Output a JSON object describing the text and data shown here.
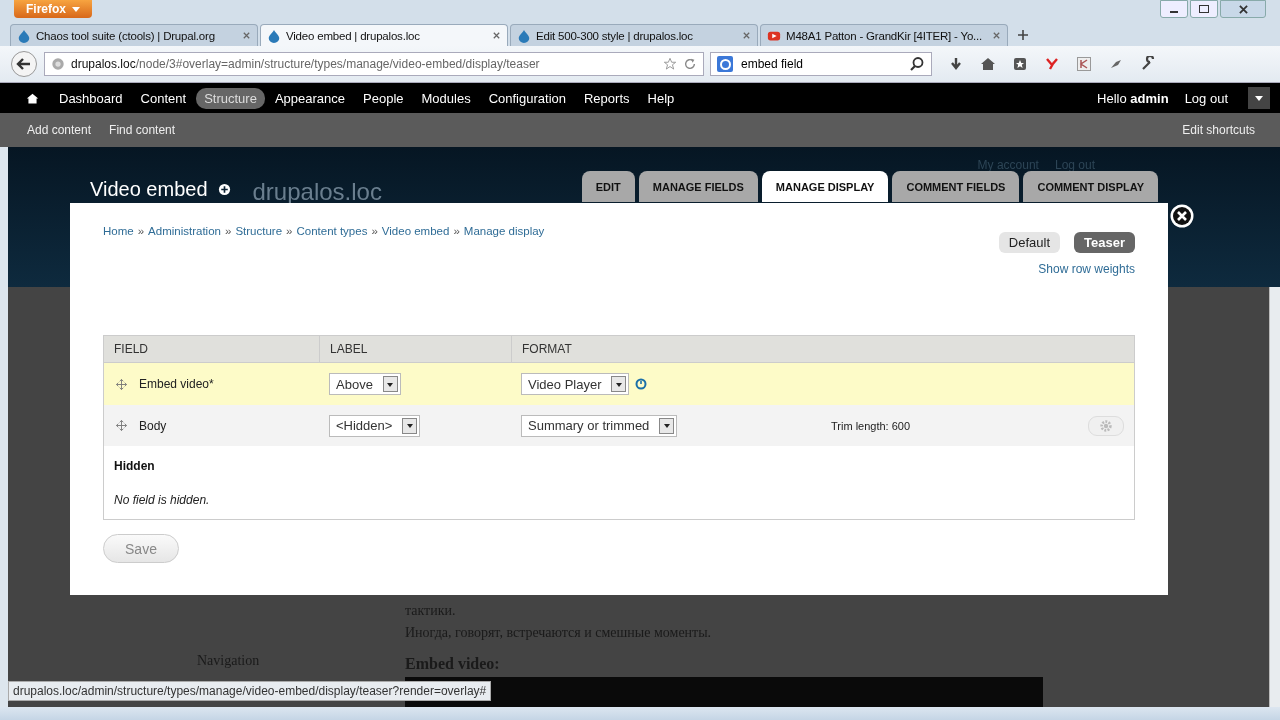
{
  "browser": {
    "menu_button": "Firefox",
    "tabs": [
      {
        "title": "Chaos tool suite (ctools) | Drupal.org",
        "kind": "drupal",
        "selected": false
      },
      {
        "title": "Video embed | drupalos.loc",
        "kind": "drupal",
        "selected": true
      },
      {
        "title": "Edit 500-300 style | drupalos.loc",
        "kind": "drupal",
        "selected": false
      },
      {
        "title": "M48A1 Patton - GrandKir [4ITER] - Yo...",
        "kind": "video",
        "selected": false
      }
    ],
    "url_host": "drupalos.loc",
    "url_path": "/node/3#overlay=admin/structure/types/manage/video-embed/display/teaser",
    "search": "embed field"
  },
  "toolbar": {
    "items": [
      {
        "label": "Dashboard",
        "selected": false
      },
      {
        "label": "Content",
        "selected": false
      },
      {
        "label": "Structure",
        "selected": true
      },
      {
        "label": "Appearance",
        "selected": false
      },
      {
        "label": "People",
        "selected": false
      },
      {
        "label": "Modules",
        "selected": false
      },
      {
        "label": "Configuration",
        "selected": false
      },
      {
        "label": "Reports",
        "selected": false
      },
      {
        "label": "Help",
        "selected": false
      }
    ],
    "greeting": "Hello **admin**",
    "logout": "Log out"
  },
  "shortcuts": {
    "items": [
      "Add content",
      "Find content"
    ],
    "edit": "Edit shortcuts"
  },
  "header": {
    "title": "Video embed",
    "site_name": "drupalos.loc",
    "user_links": [
      "My account",
      "Log out"
    ],
    "tabs": [
      {
        "label": "EDIT",
        "selected": false
      },
      {
        "label": "MANAGE FIELDS",
        "selected": false
      },
      {
        "label": "MANAGE DISPLAY",
        "selected": true
      },
      {
        "label": "COMMENT FIELDS",
        "selected": false
      },
      {
        "label": "COMMENT DISPLAY",
        "selected": false
      }
    ]
  },
  "dialog": {
    "breadcrumb_separator": "»",
    "breadcrumb": [
      "Home",
      "Administration",
      "Structure",
      "Content types",
      "Video embed",
      "Manage display"
    ],
    "view_modes": [
      {
        "label": "Default",
        "selected": false
      },
      {
        "label": "Teaser",
        "selected": true
      }
    ],
    "row_weights_link": "Show row weights",
    "columns": [
      "FIELD",
      "LABEL",
      "FORMAT"
    ],
    "rows": [
      {
        "field": "Embed video*",
        "label": "Above",
        "format": "Video Player",
        "changed": true,
        "settings_button": false
      },
      {
        "field": "Body",
        "label": "<Hidden>",
        "format": "Summary or trimmed",
        "summary": "Trim length: 600",
        "changed": false,
        "settings_button": true
      }
    ],
    "hidden_heading": "Hidden",
    "hidden_empty": "No field is hidden.",
    "save": "Save"
  },
  "page": {
    "sidebar_heading": "Navigation",
    "lines": [
      "тактики.",
      "Иногда, говорят, встречаются и смешные моменты."
    ],
    "embed_heading": "Embed video:"
  },
  "status_url": "drupalos.loc/admin/structure/types/manage/video-embed/display/teaser?render=overlay#"
}
